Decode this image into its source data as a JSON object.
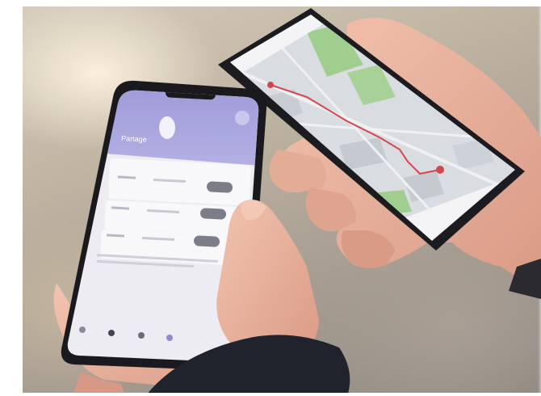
{
  "photo": {
    "subject": "hands-holding-two-smartphones",
    "colors": {
      "app_purple": "#a9a6de",
      "app_purple_dark": "#8f8ccc",
      "map_green": "#9fce8f",
      "map_base": "#d9dde2",
      "route_red": "#d4474f"
    }
  },
  "front_phone": {
    "screen_title": "Partage"
  }
}
